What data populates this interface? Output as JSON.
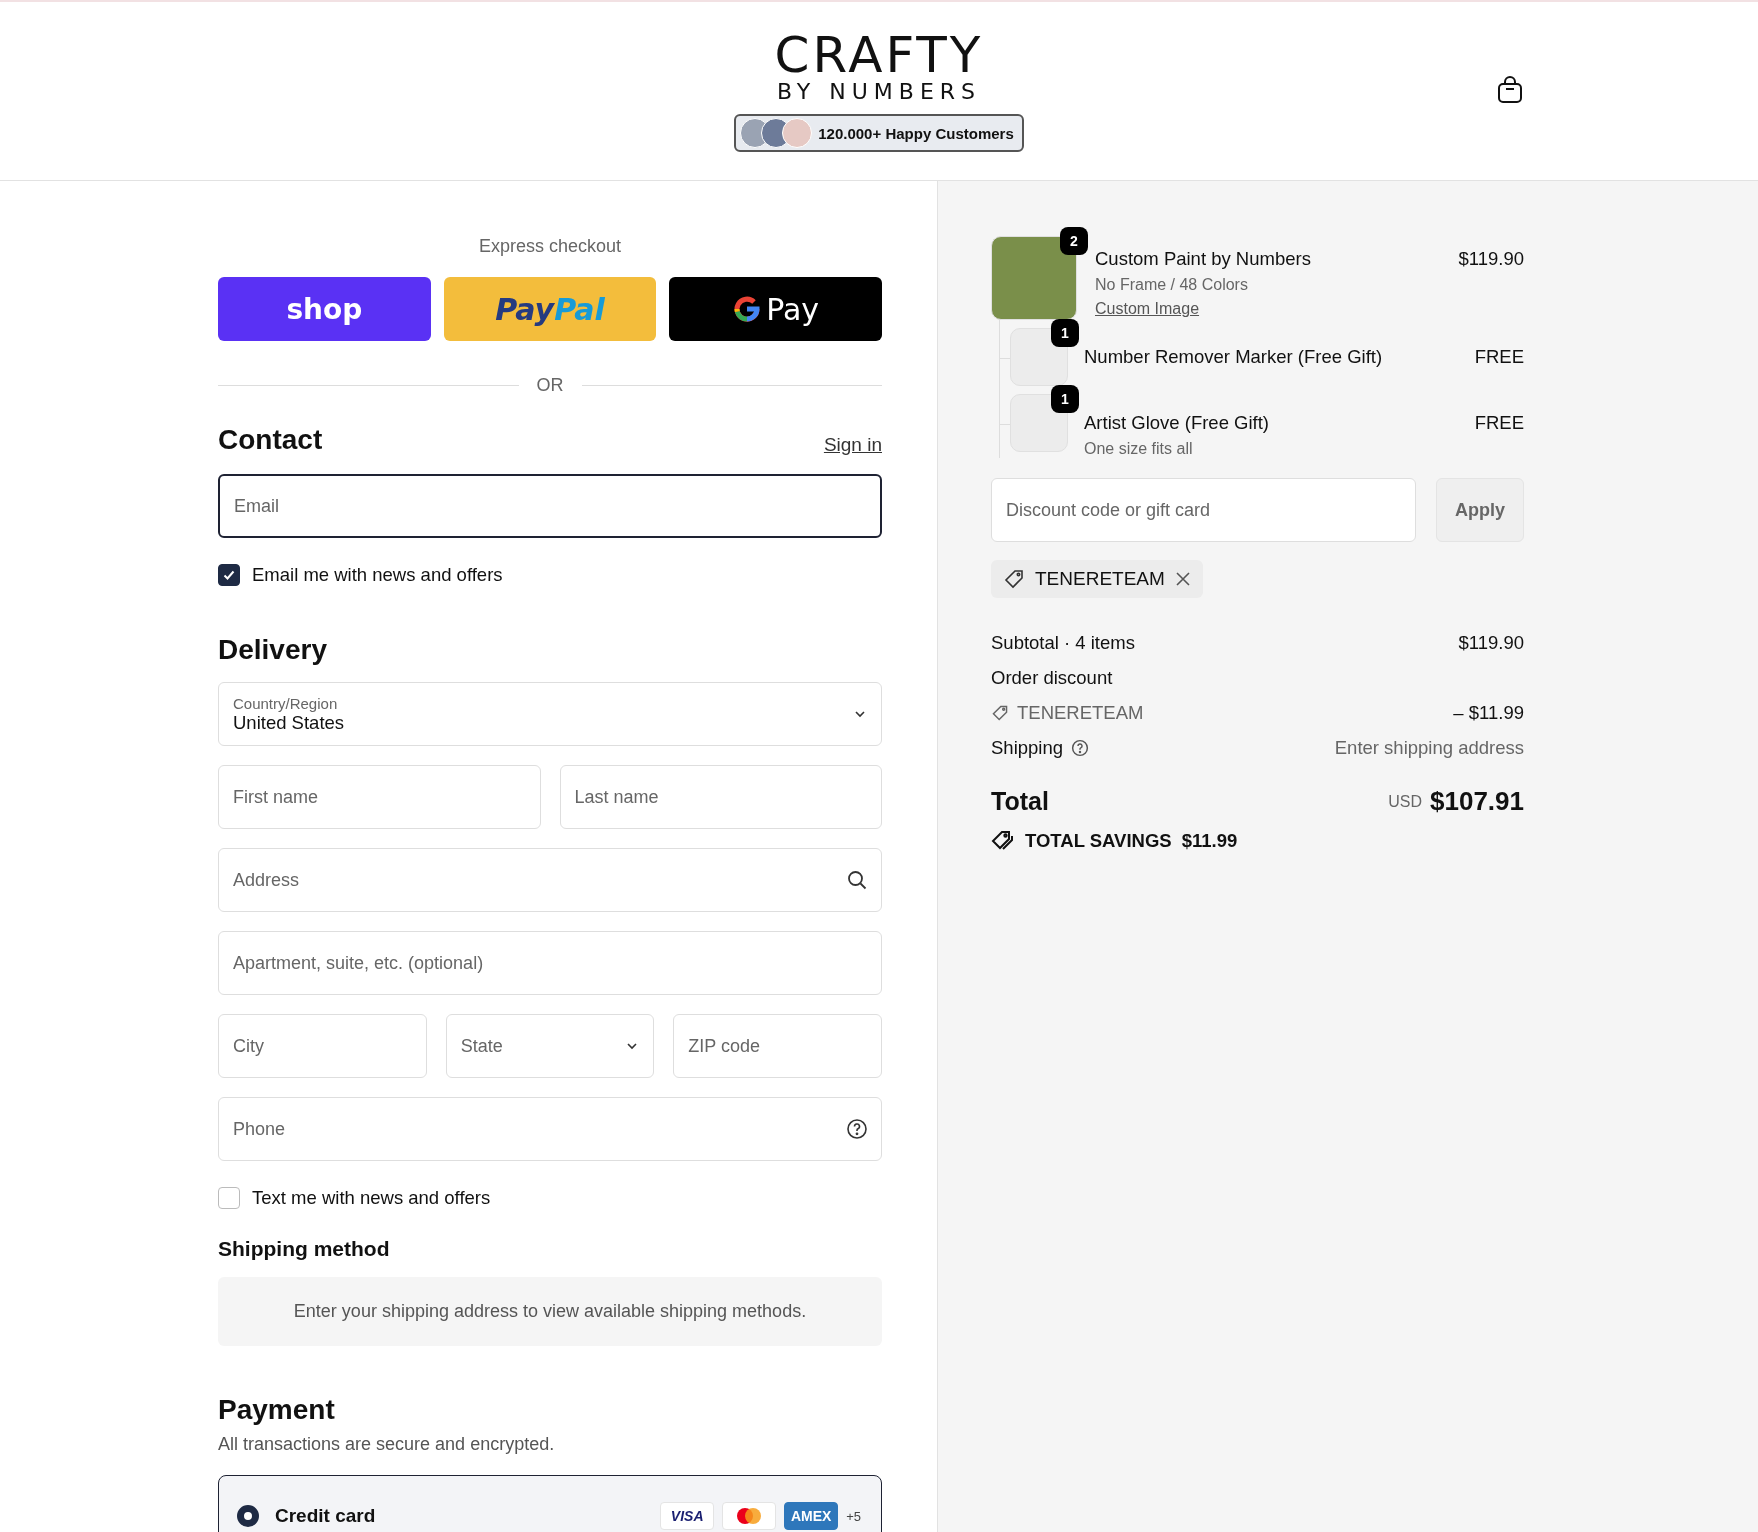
{
  "header": {
    "logo_title": "CRAFTY",
    "logo_subtitle": "BY NUMBERS",
    "badge": "120.000+ Happy Customers"
  },
  "express": {
    "label": "Express checkout",
    "buttons": [
      {
        "kind": "shop",
        "label": "shop"
      },
      {
        "kind": "paypal",
        "label": "Pay",
        "label_2": "Pal"
      },
      {
        "kind": "gpay",
        "label": "Pay"
      }
    ],
    "divider": "OR"
  },
  "contact": {
    "heading": "Contact",
    "sign_in": "Sign in",
    "email": {
      "placeholder": "Email",
      "focused": true
    },
    "news": {
      "label": "Email me with news and offers",
      "checked": true
    }
  },
  "delivery": {
    "heading": "Delivery",
    "rows": [
      {
        "fields": [
          {
            "kind": "select",
            "label": "Country/Region",
            "value": "United States"
          }
        ]
      },
      {
        "fields": [
          {
            "kind": "text",
            "placeholder": "First name"
          },
          {
            "kind": "text",
            "placeholder": "Last name"
          }
        ]
      },
      {
        "fields": [
          {
            "kind": "search",
            "placeholder": "Address"
          }
        ]
      },
      {
        "fields": [
          {
            "kind": "text",
            "placeholder": "Apartment, suite, etc. (optional)"
          }
        ]
      },
      {
        "fields": [
          {
            "kind": "text",
            "placeholder": "City"
          },
          {
            "kind": "dropdown",
            "placeholder": "State"
          },
          {
            "kind": "text",
            "placeholder": "ZIP code"
          }
        ]
      },
      {
        "fields": [
          {
            "kind": "help",
            "placeholder": "Phone"
          }
        ]
      }
    ],
    "sms": {
      "label": "Text me with news and offers",
      "checked": false
    }
  },
  "shipping_method": {
    "heading": "Shipping method",
    "notice": "Enter your shipping address to view available shipping methods."
  },
  "payment": {
    "heading": "Payment",
    "subtitle": "All transactions are secure and encrypted.",
    "methods": [
      {
        "label": "Credit card",
        "selected": true,
        "cards": [
          {
            "kind": "visa",
            "label": "VISA"
          },
          {
            "kind": "mastercard"
          },
          {
            "kind": "amex",
            "label": "AMEX"
          },
          {
            "kind": "more",
            "label": "+5"
          }
        ]
      }
    ]
  },
  "summary": {
    "items": [
      {
        "title": "Custom Paint by Numbers",
        "quantity": "2",
        "variant": "No Frame / 48 Colors",
        "link": "Custom Image",
        "price": "$119.90",
        "children": [
          {
            "title": "Number Remover Marker (Free Gift)",
            "quantity": "1",
            "price": "FREE"
          },
          {
            "title": "Artist Glove (Free Gift)",
            "quantity": "1",
            "variant": "One size fits all",
            "price": "FREE"
          }
        ]
      }
    ],
    "discount": {
      "placeholder": "Discount code or gift card",
      "button": "Apply"
    },
    "applied_codes": [
      "TENERETEAM"
    ],
    "subtotal": {
      "label": "Subtotal · 4 items",
      "value": "$119.90"
    },
    "order_discount": {
      "label": "Order discount",
      "code": "TENERETEAM",
      "value": "– $11.99"
    },
    "shipping": {
      "label": "Shipping",
      "value": "Enter shipping address"
    },
    "total": {
      "label": "Total",
      "currency": "USD",
      "value": "$107.91"
    },
    "savings": {
      "label": "TOTAL SAVINGS",
      "value": "$11.99"
    }
  }
}
